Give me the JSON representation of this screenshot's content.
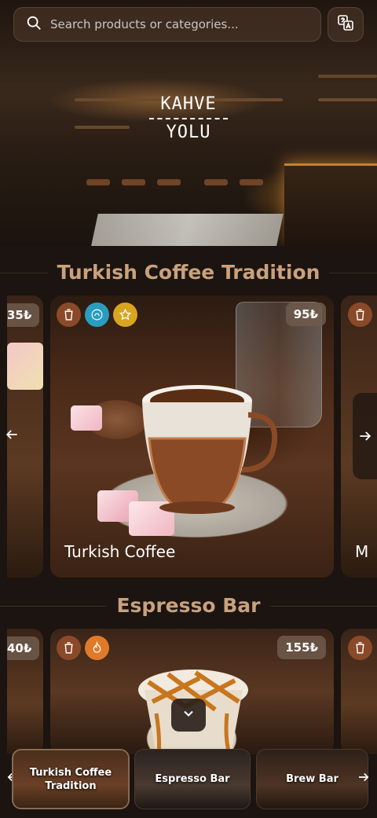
{
  "search": {
    "placeholder": "Search products or categories..."
  },
  "logo": {
    "line1": "KAHVE",
    "line2": "YOLU"
  },
  "sections": [
    {
      "title": "Turkish Coffee Tradition",
      "left_peek_price": "35₺",
      "main": {
        "name": "Turkish Coffee",
        "price": "95₺",
        "badges": [
          "cup-icon",
          "halal-icon",
          "star-icon"
        ]
      },
      "right_peek_name": "M"
    },
    {
      "title": "Espresso Bar",
      "left_peek_price": "40₺",
      "main": {
        "name": "",
        "price": "155₺",
        "badges": [
          "cup-icon",
          "flame-icon"
        ]
      }
    }
  ],
  "bottom_nav": [
    "Turkish Coffee Tradition",
    "Espresso Bar",
    "Brew Bar"
  ],
  "colors": {
    "accent": "#c9a17c",
    "badge_brown": "#8a4a2a",
    "badge_teal": "#2a9cc0",
    "badge_gold": "#d8a520",
    "badge_orange": "#e07a2a"
  }
}
